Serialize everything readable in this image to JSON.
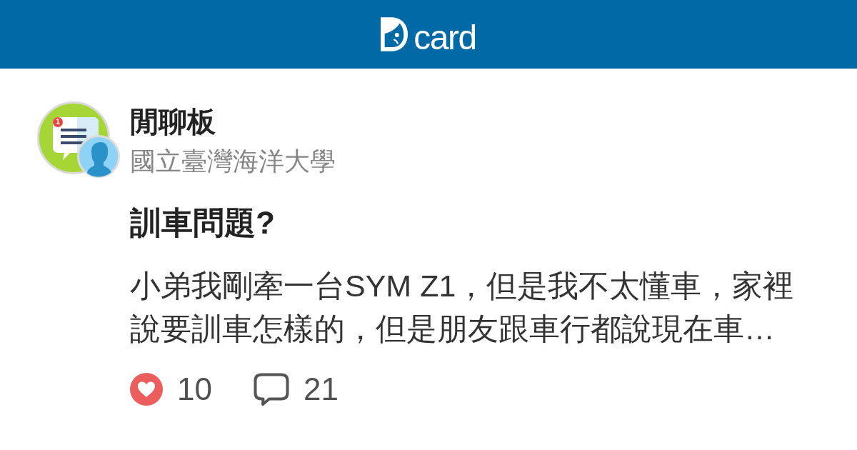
{
  "header": {
    "logo_text": "card"
  },
  "board": {
    "badge": "1",
    "name": "閒聊板",
    "school": "國立臺灣海洋大學"
  },
  "post": {
    "title": "訓車問題?",
    "excerpt": "小弟我剛牽一台SYM Z1，但是我不太懂車，家裡說要訓車怎樣的，但是朋友跟車行都說現在車…",
    "likes": "10",
    "comments": "21"
  }
}
